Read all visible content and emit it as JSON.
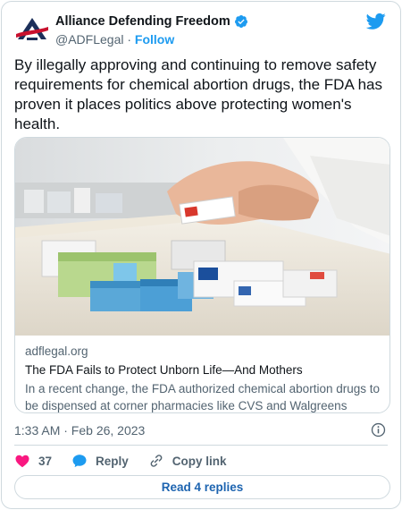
{
  "author": {
    "display_name": "Alliance Defending Freedom",
    "handle": "@ADFLegal",
    "separator": "·",
    "follow_label": "Follow"
  },
  "tweet": {
    "text": "By illegally approving and continuing to remove safety requirements for chemical abortion drugs, the FDA has proven it places politics above protecting women's health."
  },
  "link_card": {
    "domain": "adflegal.org",
    "title": "The FDA Fails to Protect Unborn Life—And Mothers",
    "description": "In a recent change, the FDA authorized chemical abortion drugs to be dispensed at corner pharmacies like CVS and Walgreens rather than..."
  },
  "meta": {
    "timestamp": "1:33 AM · Feb 26, 2023"
  },
  "actions": {
    "likes_count": "37",
    "reply_label": "Reply",
    "copy_link_label": "Copy link"
  },
  "footer": {
    "read_replies_label": "Read 4 replies"
  },
  "colors": {
    "accent": "#1d9bf0",
    "like": "#f91880",
    "secondary_text": "#536471",
    "border": "#cfd9de"
  },
  "icons": [
    "adf-logo-icon",
    "verified-badge-icon",
    "twitter-bird-icon",
    "info-icon",
    "heart-icon",
    "reply-bubble-icon",
    "link-icon"
  ]
}
